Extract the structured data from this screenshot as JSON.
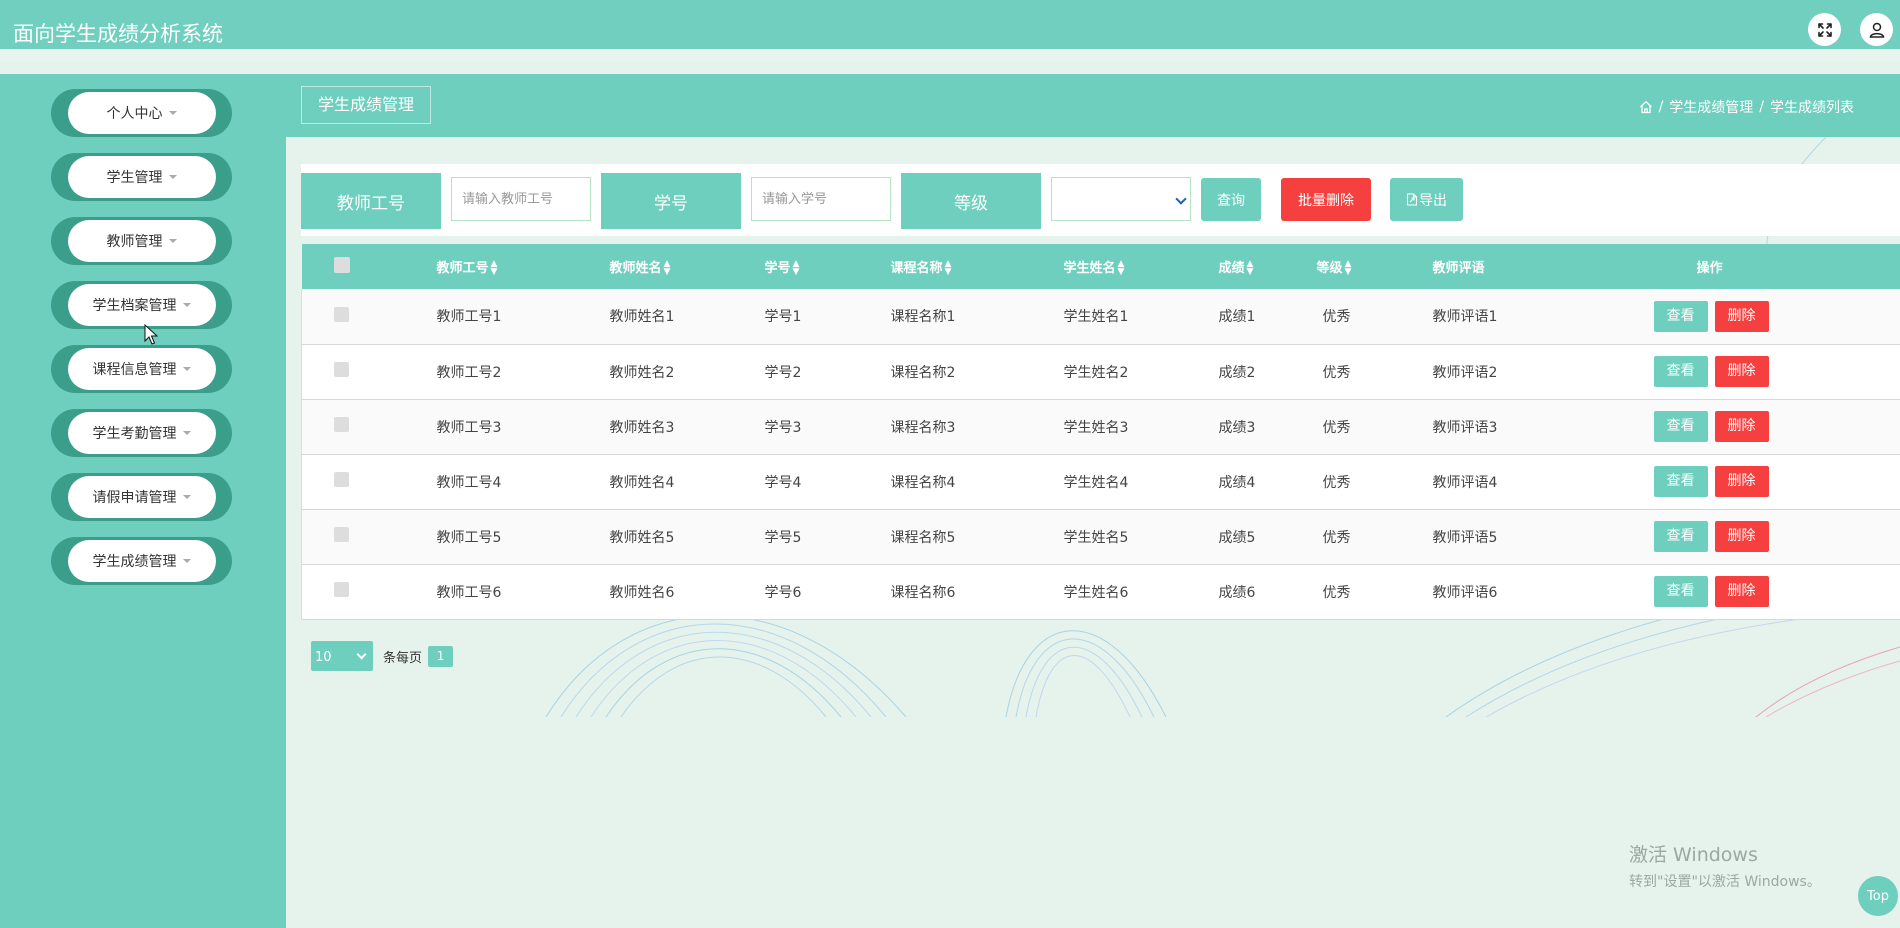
{
  "header": {
    "app_title": "面向学生成绩分析系统",
    "icons": [
      "fullscreen-icon",
      "user-icon"
    ]
  },
  "sidebar": {
    "items": [
      {
        "label": "个人中心"
      },
      {
        "label": "学生管理"
      },
      {
        "label": "教师管理"
      },
      {
        "label": "学生档案管理"
      },
      {
        "label": "课程信息管理"
      },
      {
        "label": "学生考勤管理"
      },
      {
        "label": "请假申请管理"
      },
      {
        "label": "学生成绩管理"
      }
    ]
  },
  "page": {
    "title": "学生成绩管理",
    "breadcrumb": [
      "学生成绩管理",
      "学生成绩列表"
    ],
    "breadcrumb_sep": "/"
  },
  "search": {
    "teacher_id_label": "教师工号",
    "teacher_id_placeholder": "请输入教师工号",
    "student_id_label": "学号",
    "student_id_placeholder": "请输入学号",
    "grade_label": "等级",
    "grade_value": "",
    "query_button": "查询",
    "batch_delete_button": "批量删除",
    "export_button": "导出"
  },
  "table": {
    "columns": [
      "教师工号",
      "教师姓名",
      "学号",
      "课程名称",
      "学生姓名",
      "成绩",
      "等级",
      "教师评语",
      "操作"
    ],
    "rows": [
      [
        "教师工号1",
        "教师姓名1",
        "学号1",
        "课程名称1",
        "学生姓名1",
        "成绩1",
        "优秀",
        "教师评语1"
      ],
      [
        "教师工号2",
        "教师姓名2",
        "学号2",
        "课程名称2",
        "学生姓名2",
        "成绩2",
        "优秀",
        "教师评语2"
      ],
      [
        "教师工号3",
        "教师姓名3",
        "学号3",
        "课程名称3",
        "学生姓名3",
        "成绩3",
        "优秀",
        "教师评语3"
      ],
      [
        "教师工号4",
        "教师姓名4",
        "学号4",
        "课程名称4",
        "学生姓名4",
        "成绩4",
        "优秀",
        "教师评语4"
      ],
      [
        "教师工号5",
        "教师姓名5",
        "学号5",
        "课程名称5",
        "学生姓名5",
        "成绩5",
        "优秀",
        "教师评语5"
      ],
      [
        "教师工号6",
        "教师姓名6",
        "学号6",
        "课程名称6",
        "学生姓名6",
        "成绩6",
        "优秀",
        "教师评语6"
      ]
    ],
    "view_button": "查看",
    "delete_button": "删除"
  },
  "pager": {
    "page_size": "10",
    "per_page_label": "条每页",
    "current_page": "1"
  },
  "watermark": {
    "title": "激活 Windows",
    "subtitle": "转到\"设置\"以激活 Windows。"
  },
  "top_button": "Top",
  "colors": {
    "primary": "#6fcfbf",
    "danger": "#f5403f",
    "menu_pill": "#3a9e8b",
    "background": "#e6f2ec"
  }
}
